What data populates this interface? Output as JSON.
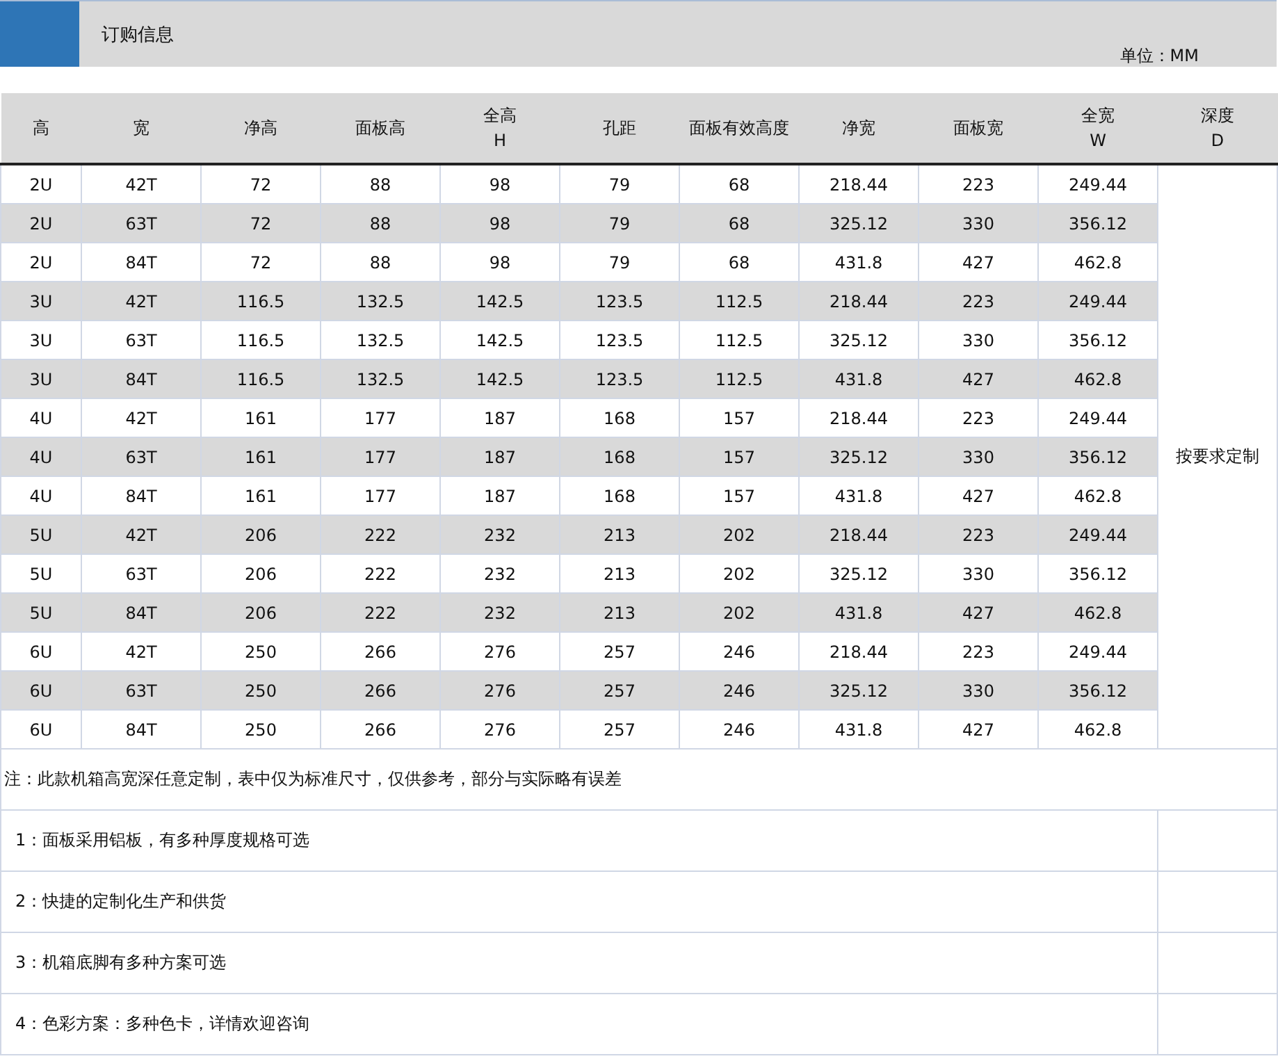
{
  "title": "订购信息",
  "unit": "单位：MM",
  "columns": [
    "高",
    "宽",
    "净高",
    "面板高",
    "全高\nH",
    "孔距",
    "面板有效高度",
    "净宽",
    "面板宽",
    "全宽\nW",
    "深度\nD"
  ],
  "rows": [
    [
      "2U",
      "42T",
      "72",
      "88",
      "98",
      "79",
      "68",
      "218.44",
      "223",
      "249.44"
    ],
    [
      "2U",
      "63T",
      "72",
      "88",
      "98",
      "79",
      "68",
      "325.12",
      "330",
      "356.12"
    ],
    [
      "2U",
      "84T",
      "72",
      "88",
      "98",
      "79",
      "68",
      "431.8",
      "427",
      "462.8"
    ],
    [
      "3U",
      "42T",
      "116.5",
      "132.5",
      "142.5",
      "123.5",
      "112.5",
      "218.44",
      "223",
      "249.44"
    ],
    [
      "3U",
      "63T",
      "116.5",
      "132.5",
      "142.5",
      "123.5",
      "112.5",
      "325.12",
      "330",
      "356.12"
    ],
    [
      "3U",
      "84T",
      "116.5",
      "132.5",
      "142.5",
      "123.5",
      "112.5",
      "431.8",
      "427",
      "462.8"
    ],
    [
      "4U",
      "42T",
      "161",
      "177",
      "187",
      "168",
      "157",
      "218.44",
      "223",
      "249.44"
    ],
    [
      "4U",
      "63T",
      "161",
      "177",
      "187",
      "168",
      "157",
      "325.12",
      "330",
      "356.12"
    ],
    [
      "4U",
      "84T",
      "161",
      "177",
      "187",
      "168",
      "157",
      "431.8",
      "427",
      "462.8"
    ],
    [
      "5U",
      "42T",
      "206",
      "222",
      "232",
      "213",
      "202",
      "218.44",
      "223",
      "249.44"
    ],
    [
      "5U",
      "63T",
      "206",
      "222",
      "232",
      "213",
      "202",
      "325.12",
      "330",
      "356.12"
    ],
    [
      "5U",
      "84T",
      "206",
      "222",
      "232",
      "213",
      "202",
      "431.8",
      "427",
      "462.8"
    ],
    [
      "6U",
      "42T",
      "250",
      "266",
      "276",
      "257",
      "246",
      "218.44",
      "223",
      "249.44"
    ],
    [
      "6U",
      "63T",
      "250",
      "266",
      "276",
      "257",
      "246",
      "325.12",
      "330",
      "356.12"
    ],
    [
      "6U",
      "84T",
      "250",
      "266",
      "276",
      "257",
      "246",
      "431.8",
      "427",
      "462.8"
    ]
  ],
  "depth_note": "按要求定制",
  "note": "注：此款机箱高宽深任意定制，表中仅为标准尺寸，仅供参考，部分与实际略有误差",
  "features": [
    "1：面板采用铝板，有多种厚度规格可选",
    "2：快捷的定制化生产和供货",
    "3：机箱底脚有多种方案可选",
    "4：色彩方案：多种色卡，详情欢迎咨询"
  ]
}
